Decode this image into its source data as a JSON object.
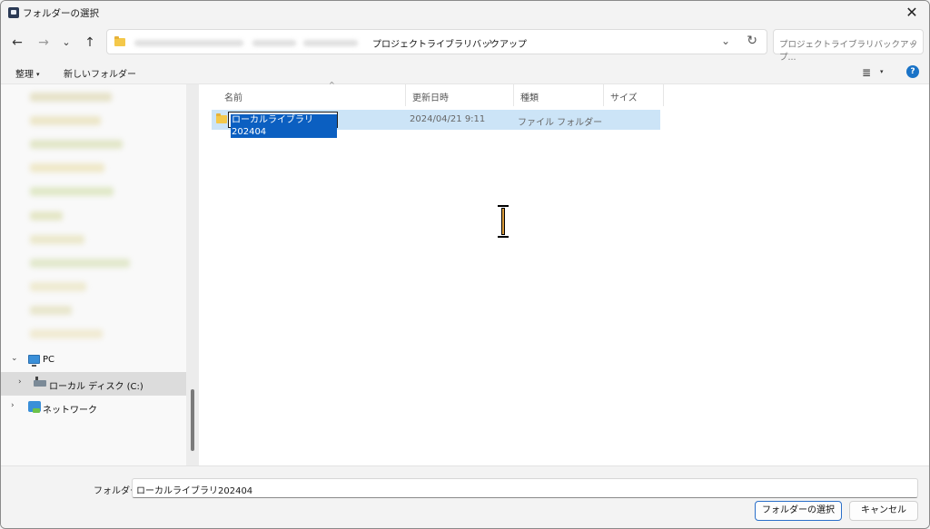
{
  "window": {
    "title": "フォルダーの選択",
    "close_glyph": "✕"
  },
  "nav": {
    "back_glyph": "←",
    "forward_glyph": "→",
    "recent_glyph": "⌄",
    "up_glyph": "↑",
    "breadcrumb_current": "プロジェクトライブラリバックアップ",
    "breadcrumb_chevron": "›",
    "dropdown_glyph": "⌄",
    "refresh_glyph": "↻",
    "search_placeholder": "プロジェクトライブラリバックアップ...",
    "search_glyph": "⌕"
  },
  "toolbar": {
    "organize_label": "整理",
    "organize_caret": "▾",
    "new_folder_label": "新しいフォルダー",
    "view_glyph": "≣",
    "view_caret": "▾",
    "help_glyph": "?"
  },
  "tree": {
    "pc_label": "PC",
    "pc_chevron": "⌄",
    "local_disk_label": "ローカル ディスク (C:)",
    "local_disk_chevron": "›",
    "network_label": "ネットワーク",
    "network_chevron": "›"
  },
  "columns": {
    "name": "名前",
    "modified": "更新日時",
    "type": "種類",
    "size": "サイズ",
    "sort_caret": "^"
  },
  "files": [
    {
      "name": "ローカルライブラリ202404",
      "modified": "2024/04/21 9:11",
      "type": "ファイル フォルダー",
      "size": ""
    }
  ],
  "footer": {
    "folder_label": "フォルダー:",
    "folder_value": "ローカルライブラリ202404",
    "select_button": "フォルダーの選択",
    "cancel_button": "キャンセル"
  }
}
